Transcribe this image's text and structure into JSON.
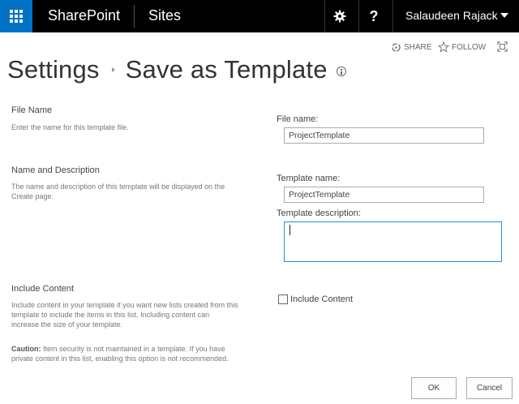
{
  "suitebar": {
    "brand": "SharePoint",
    "sites": "Sites",
    "help": "?",
    "user": "Salaudeen Rajack"
  },
  "actions": {
    "share": "SHARE",
    "follow": "FOLLOW"
  },
  "title": {
    "parent": "Settings",
    "current": "Save as Template"
  },
  "sections": {
    "file": {
      "title": "File Name",
      "description": "Enter the name for this template file.",
      "label": "File name:",
      "value": "ProjectTemplate"
    },
    "name": {
      "title": "Name and Description",
      "description": "The name and description of this template will be displayed on the Create page.",
      "name_label": "Template name:",
      "name_value": "ProjectTemplate",
      "desc_label": "Template description:",
      "desc_value": ""
    },
    "content": {
      "title": "Include Content",
      "description": "Include content in your template if you want new lists created from this template to include the items in this list. Including content can increase the size of your template.",
      "caution_label": "Caution:",
      "caution_text": " Item security is not maintained in a template. If you have private content in this list, enabling this option is not recommended.",
      "checkbox_label": "Include Content",
      "checked": false
    }
  },
  "buttons": {
    "ok": "OK",
    "cancel": "Cancel"
  },
  "colors": {
    "suitebar": "#000000",
    "waffle": "#0072c6",
    "focus_border": "#2a8dd4"
  }
}
